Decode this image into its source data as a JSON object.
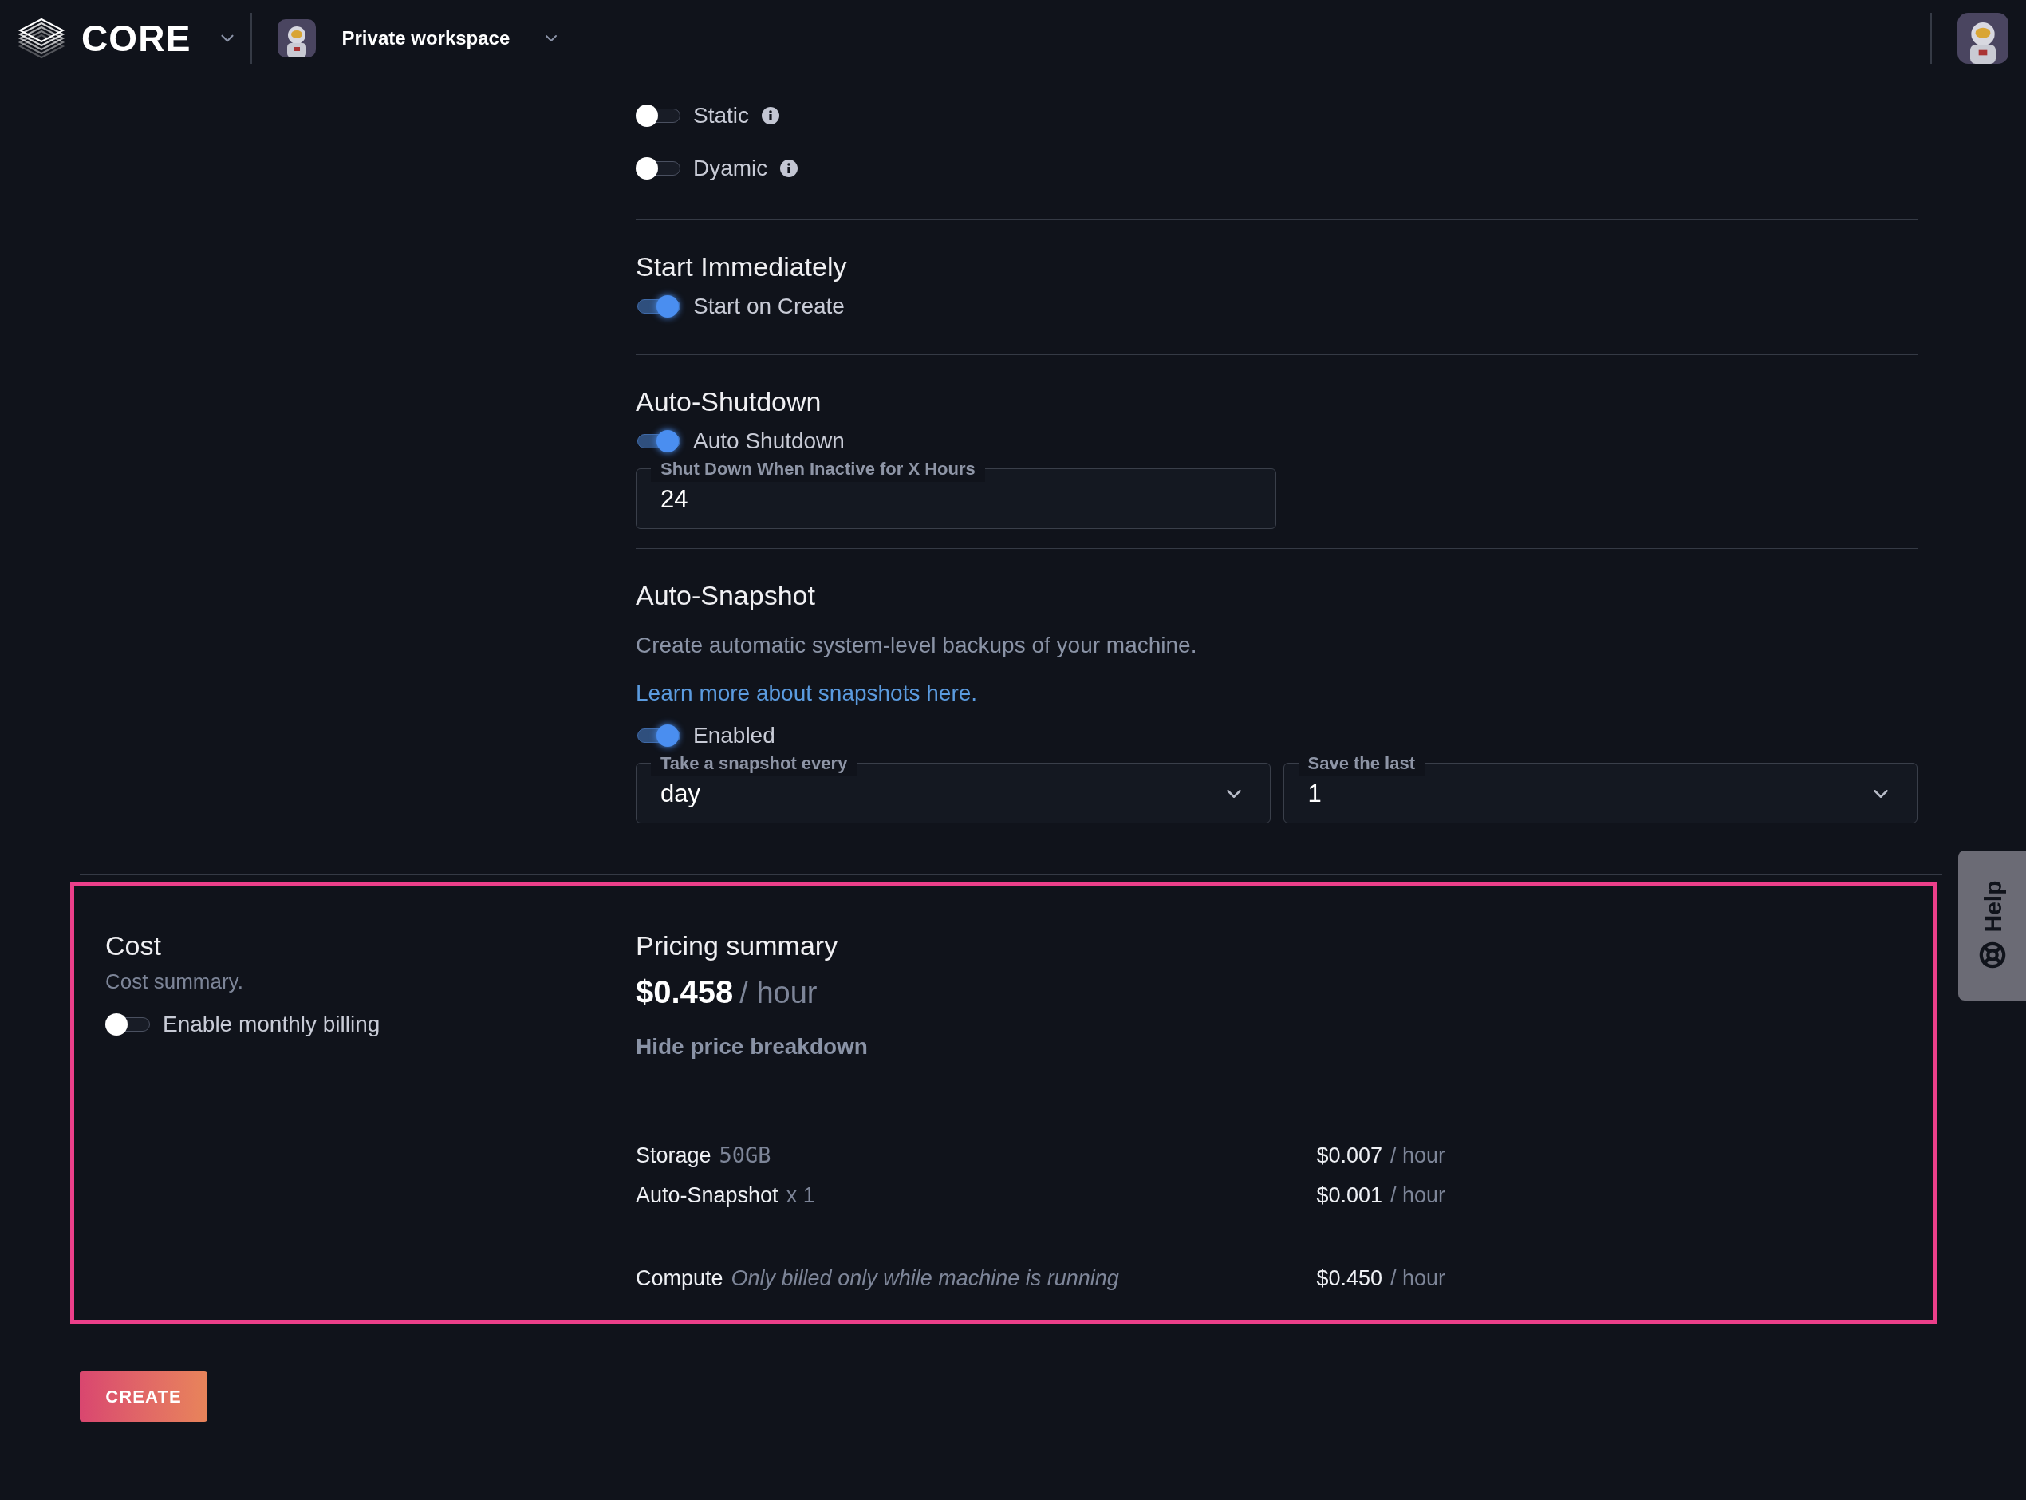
{
  "header": {
    "logo_text": "CORE",
    "workspace": "Private workspace"
  },
  "public_ip": {
    "options": [
      {
        "label": "Static",
        "on": false
      },
      {
        "label": "Dyamic",
        "on": false
      }
    ]
  },
  "start_immediately": {
    "title": "Start Immediately",
    "toggle": {
      "label": "Start on Create",
      "on": true
    }
  },
  "auto_shutdown": {
    "title": "Auto-Shutdown",
    "toggle": {
      "label": "Auto Shutdown",
      "on": true
    },
    "field": {
      "label": "Shut Down When Inactive for X Hours",
      "value": "24"
    }
  },
  "auto_snapshot": {
    "title": "Auto-Snapshot",
    "description": "Create automatic system-level backups of your machine.",
    "link": "Learn more about snapshots here.",
    "toggle": {
      "label": "Enabled",
      "on": true
    },
    "selects": [
      {
        "label": "Take a snapshot every",
        "value": "day"
      },
      {
        "label": "Save the last",
        "value": "1"
      }
    ]
  },
  "cost": {
    "title": "Cost",
    "subtitle": "Cost summary.",
    "toggle": {
      "label": "Enable monthly billing",
      "on": false
    }
  },
  "pricing": {
    "title": "Pricing summary",
    "price": "$0.458",
    "unit": "/ hour",
    "breakdown_toggle": "Hide price breakdown",
    "items": [
      {
        "kind": "size",
        "name": "Storage",
        "detail": "50GB",
        "price": "$0.007",
        "unit": "/ hour"
      },
      {
        "kind": "count",
        "name": "Auto-Snapshot",
        "detail": "x 1",
        "price": "$0.001",
        "unit": "/ hour"
      },
      {
        "kind": "note",
        "name": "Compute",
        "detail": "Only billed only while machine is running",
        "price": "$0.450",
        "unit": "/ hour"
      }
    ]
  },
  "help": {
    "label": "Help"
  },
  "create_button": "CREATE"
}
